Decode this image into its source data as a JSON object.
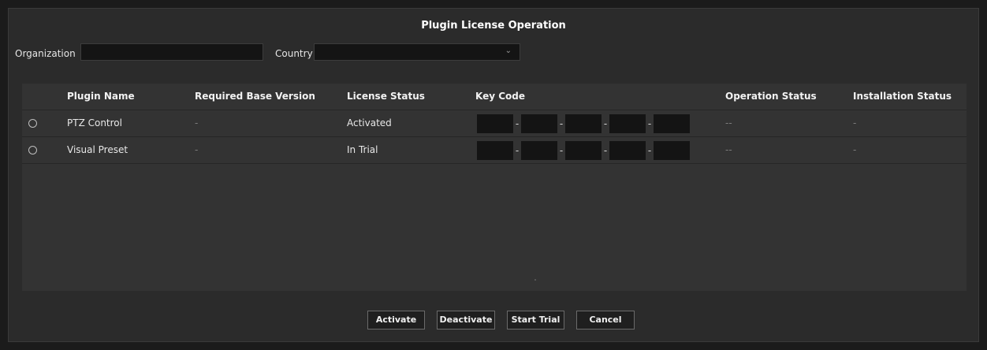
{
  "dialog": {
    "title": "Plugin License Operation"
  },
  "filters": {
    "organization_label": "Organization",
    "organization_value": "",
    "country_label": "Country",
    "country_value": "",
    "country_icon": "chevron-down-icon"
  },
  "table": {
    "headers": [
      "Plugin Name",
      "Required Base Version",
      "License Status",
      "Key Code",
      "Operation Status",
      "Installation Status"
    ],
    "rows": [
      {
        "selected": false,
        "name": "PTZ Control",
        "required_base_version": "-",
        "license_status": "Activated",
        "key_code": [
          "",
          "",
          "",
          "",
          ""
        ],
        "key_separator": "-",
        "operation_status": "--",
        "installation_status": "-"
      },
      {
        "selected": false,
        "name": "Visual Preset",
        "required_base_version": "-",
        "license_status": "In Trial",
        "key_code": [
          "",
          "",
          "",
          "",
          ""
        ],
        "key_separator": "-",
        "operation_status": "--",
        "installation_status": "-"
      }
    ]
  },
  "buttons": {
    "activate": "Activate",
    "deactivate": "Deactivate",
    "start_trial": "Start Trial",
    "cancel": "Cancel"
  }
}
